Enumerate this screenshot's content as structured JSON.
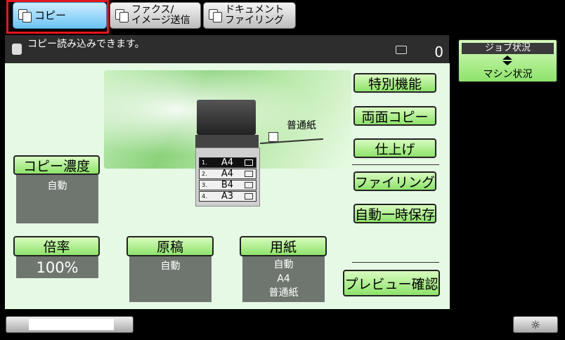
{
  "tabs": [
    {
      "label": "コピー",
      "active": true
    },
    {
      "label": "ファクス/\nイメージ送信",
      "active": false
    },
    {
      "label": "ドキュメント\nファイリング",
      "active": false
    }
  ],
  "status": {
    "message": "コピー読み込みできます。",
    "count": "0"
  },
  "job": {
    "header": "ジョブ状況",
    "footer": "マシン状況"
  },
  "right_buttons": {
    "special": "特別機能",
    "duplex": "両面コピー",
    "finish": "仕上げ",
    "filing": "ファイリング",
    "quick_save": "自動一時保存",
    "preview": "プレビュー確認"
  },
  "density": {
    "label": "コピー濃度",
    "value": "自動"
  },
  "ratio": {
    "label": "倍率",
    "value": "100%"
  },
  "original": {
    "label": "原稿",
    "value": "自動"
  },
  "paper": {
    "label": "用紙",
    "value": "自動",
    "size": "A4",
    "type": "普通紙"
  },
  "bypass": {
    "label": "普通紙"
  },
  "trays": [
    {
      "num": "1.",
      "size": "A4",
      "selected": true
    },
    {
      "num": "2.",
      "size": "A4",
      "selected": false
    },
    {
      "num": "3.",
      "size": "B4",
      "selected": false
    },
    {
      "num": "4.",
      "size": "A3",
      "selected": false
    }
  ],
  "brightness_icon": "☼",
  "colors": {
    "green_button": "#8de36a",
    "panel_bg": "#e5f9e5",
    "selection": "#e3161b",
    "active_tab": "#6cc3f4"
  }
}
